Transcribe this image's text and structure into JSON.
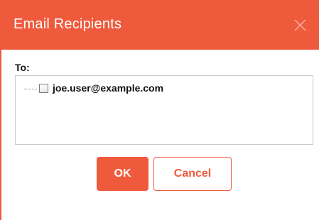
{
  "dialog": {
    "title": "Email Recipients",
    "close_icon": "close-icon",
    "to_label": "To:",
    "recipients": [
      {
        "email": "joe.user@example.com",
        "checked": false
      }
    ],
    "ok_label": "OK",
    "cancel_label": "Cancel"
  },
  "colors": {
    "accent": "#ef5a3c",
    "title_text": "#ffffff",
    "body_text": "#111111",
    "border": "#c9c9c9"
  }
}
